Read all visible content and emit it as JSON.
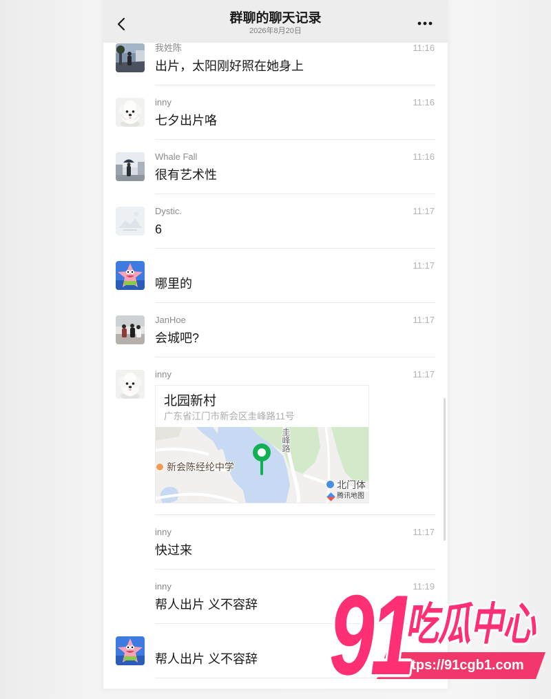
{
  "header": {
    "back_icon": "chevron-left-icon",
    "title": "群聊的聊天记录",
    "date": "2026年8月20日",
    "more_icon": "more-horizontal-icon"
  },
  "messages": [
    {
      "name": "我姓陈",
      "time": "11:16",
      "text": "出片，太阳刚好照在她身上"
    },
    {
      "name": "inny",
      "time": "11:16",
      "text": "七夕出片咯"
    },
    {
      "name": "Whale Fall",
      "time": "11:16",
      "text": "很有艺术性"
    },
    {
      "name": "Dystic.",
      "time": "11:17",
      "text": "6"
    },
    {
      "time": "11:17",
      "text": "哪里的"
    },
    {
      "name": "JanHoe",
      "time": "11:17",
      "text": "会城吧?"
    },
    {
      "name": "inny",
      "time": "11:17",
      "location": {
        "title": "北园新村",
        "address": "广东省江门市新会区圭峰路11号",
        "pin_icon": "map-pin-icon",
        "labels": {
          "road": "圭峰路",
          "school": "新会陈经纶中学",
          "poi": "北门体",
          "provider": "腾讯地图"
        }
      }
    },
    {
      "name": "inny",
      "time": "11:17",
      "text": "快过来"
    },
    {
      "name": "inny",
      "time": "11:19",
      "text": "帮人出片 义不容辞"
    },
    {
      "text": "帮人出片 义不容辞"
    }
  ],
  "watermark": {
    "number": "91",
    "brand": "吃瓜中心",
    "url": "https://91cgb1.com"
  },
  "colors": {
    "pin": "#12b054",
    "watermark": "#ff2f73",
    "banner": "#f2386a",
    "header_bg": "#ededed"
  }
}
